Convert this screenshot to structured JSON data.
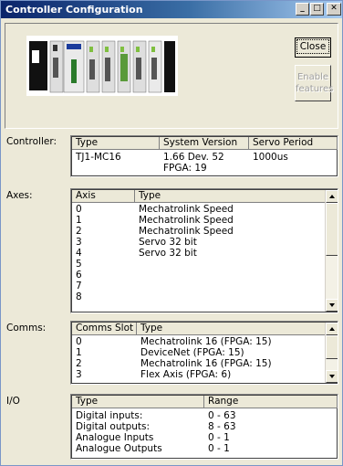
{
  "window": {
    "title": "Controller Configuration",
    "min_glyph": "_",
    "max_glyph": "□",
    "close_glyph": "✕"
  },
  "buttons": {
    "close": "Close",
    "enable_line1": "Enable",
    "enable_line2": "features"
  },
  "controller": {
    "label": "Controller:",
    "headers": [
      "Type",
      "System Version",
      "Servo Period"
    ],
    "type": "TJ1-MC16",
    "version_line1": "1.66 Dev. 52",
    "version_line2": "FPGA: 19",
    "servo_period": "1000us"
  },
  "axes": {
    "label": "Axes:",
    "headers": [
      "Axis",
      "Type"
    ],
    "rows": [
      [
        "0",
        "Mechatrolink Speed"
      ],
      [
        "1",
        "Mechatrolink Speed"
      ],
      [
        "2",
        "Mechatrolink Speed"
      ],
      [
        "3",
        "Servo 32 bit"
      ],
      [
        "4",
        "Servo 32 bit"
      ],
      [
        "5",
        ""
      ],
      [
        "6",
        ""
      ],
      [
        "7",
        ""
      ],
      [
        "8",
        ""
      ]
    ]
  },
  "comms": {
    "label": "Comms:",
    "headers": [
      "Comms Slot",
      "Type"
    ],
    "rows": [
      [
        "0",
        "Mechatrolink 16 (FPGA: 15)"
      ],
      [
        "1",
        "DeviceNet (FPGA: 15)"
      ],
      [
        "2",
        "Mechatrolink 16 (FPGA: 15)"
      ],
      [
        "3",
        "Flex Axis (FPGA: 6)"
      ]
    ]
  },
  "io": {
    "label": "I/O",
    "headers": [
      "Type",
      "Range"
    ],
    "rows": [
      [
        "Digital inputs:",
        "0 - 63"
      ],
      [
        "Digital outputs:",
        "8 - 63"
      ],
      [
        "Analogue Inputs",
        "0 - 1"
      ],
      [
        "Analogue Outputs",
        "0 - 1"
      ]
    ]
  },
  "colors": {
    "face": "#ece9d8",
    "title_start": "#0a246a",
    "title_end": "#a6caf0",
    "module_green": "#5a9a3a",
    "module_blue": "#1c3c9c"
  }
}
